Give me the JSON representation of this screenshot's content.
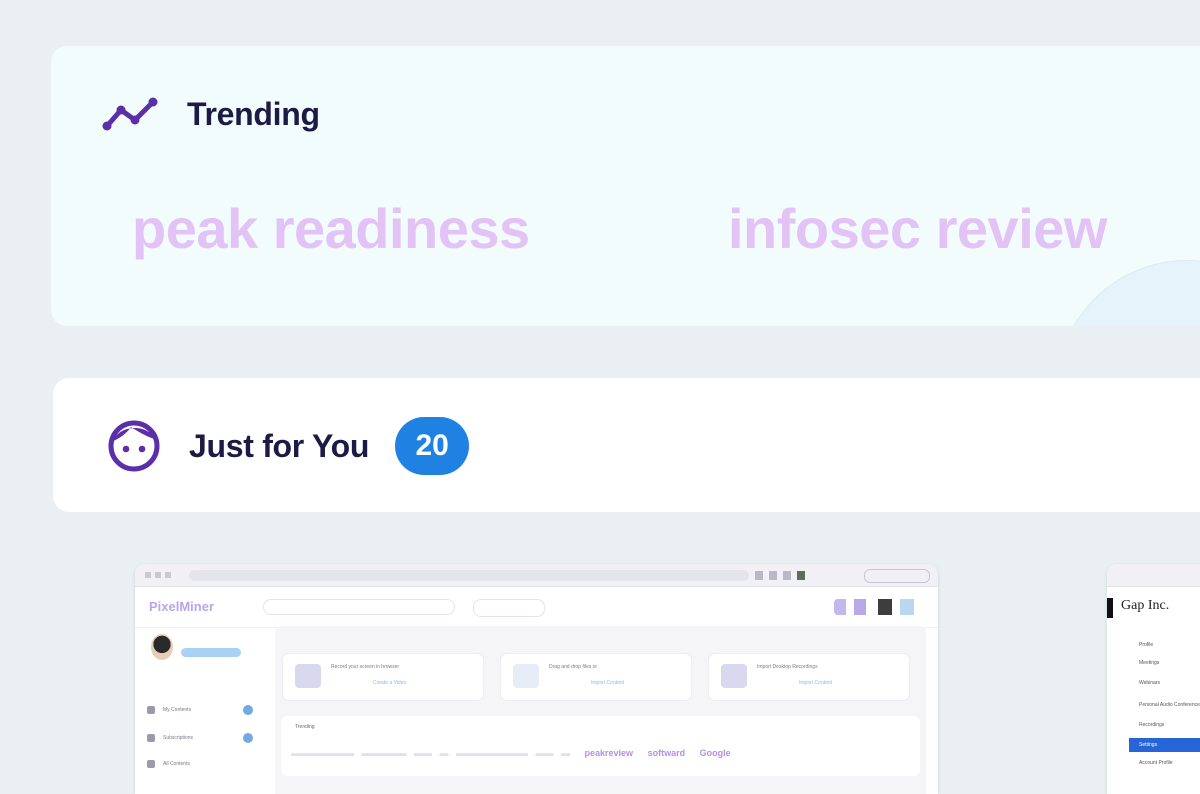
{
  "trending": {
    "title": "Trending",
    "terms": [
      "peak readiness",
      "infosec review"
    ],
    "icon": "trend-line-icon",
    "term_color": "#e3c2f6"
  },
  "for_you": {
    "title": "Just for You",
    "count": "20",
    "icon": "face-icon",
    "badge_color": "#1f82e3"
  },
  "thumbnail_1": {
    "app_logo": "PixelMiner",
    "nav_labels": [
      "My Contents",
      "Subscriptions",
      "All Contents"
    ],
    "uploads": [
      {
        "label": "Record your screen in browser",
        "action": "Create a Video"
      },
      {
        "label": "Drag and drop files or",
        "action": "Import Content"
      },
      {
        "label": "Import Desktop Recordings",
        "action": "Import Content"
      }
    ],
    "trending_header": "Trending",
    "trending_words": [
      "peakreview",
      "softward",
      "Google"
    ]
  },
  "thumbnail_2": {
    "logo": "Gap Inc.",
    "menu": [
      "Profile",
      "Meetings",
      "Webinars",
      "Personal Audio Conference",
      "Recordings",
      "Settings",
      "Account Profile"
    ],
    "active_item": "Settings"
  }
}
